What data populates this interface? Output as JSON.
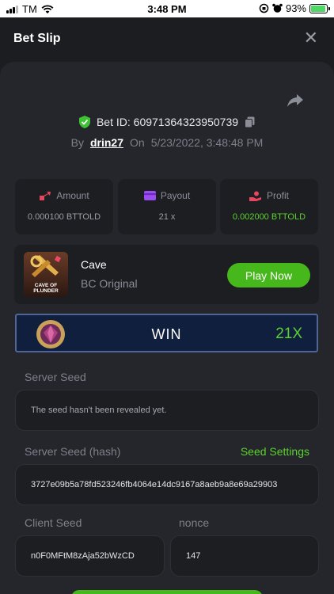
{
  "status_bar": {
    "carrier": "TM",
    "time": "3:48 PM",
    "battery": "93%",
    "battery_fill": 0.93
  },
  "header": {
    "title": "Bet Slip",
    "close": "✕"
  },
  "bet": {
    "id_label": "Bet ID: 60971364323950739",
    "by_prefix": "By",
    "user": "drin27",
    "on_prefix": "On",
    "datetime": "5/23/2022, 3:48:48 PM"
  },
  "stats": {
    "amount_label": "Amount",
    "amount_value": "0.000100 BTTOLD",
    "payout_label": "Payout",
    "payout_value": "21 x",
    "profit_label": "Profit",
    "profit_value": "0.002000 BTTOLD"
  },
  "game": {
    "name": "Cave",
    "subtitle": "BC Original",
    "thumb_text": "CAVE OF PLUNDER",
    "play_label": "Play Now"
  },
  "result": {
    "text": "WIN",
    "multiplier": "21X"
  },
  "seeds": {
    "server_label": "Server Seed",
    "server_value": "The seed hasn't been revealed yet.",
    "server_hash_label": "Server Seed (hash)",
    "seed_settings_label": "Seed Settings",
    "server_hash_value": "3727e09b5a78fd523246fb4064e14dc9167a8aeb9a8e69a29903",
    "client_label": "Client Seed",
    "client_value": "n0F0MFtM8zAja52bWzCD",
    "nonce_label": "nonce",
    "nonce_value": "147"
  },
  "colors": {
    "accent_green": "#5bd12f",
    "button_green": "#47b81c",
    "background": "#1c1d21",
    "card": "#25262b",
    "panel": "#1d1e22"
  }
}
